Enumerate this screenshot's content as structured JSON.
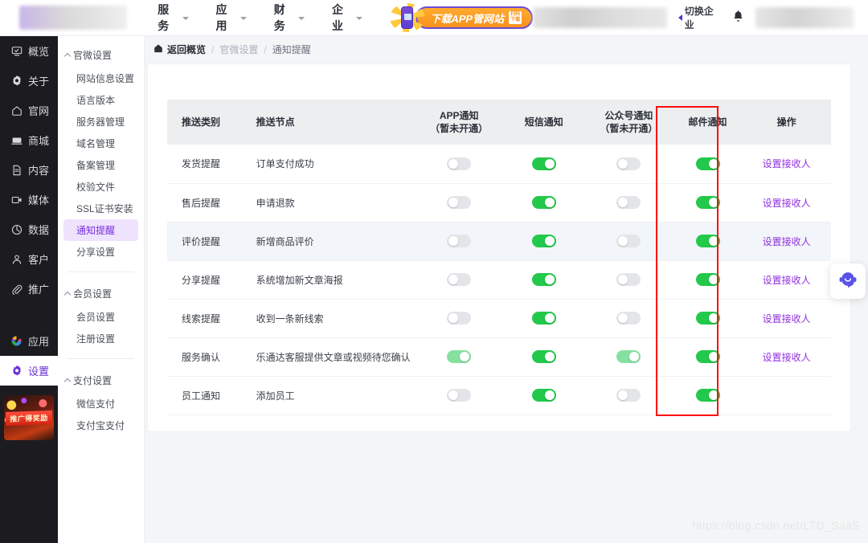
{
  "topbar": {
    "nav": [
      {
        "label": "服务",
        "icon": "chevron-down-icon"
      },
      {
        "label": "应用",
        "icon": "chevron-down-icon"
      },
      {
        "label": "财务",
        "icon": "chevron-down-icon"
      },
      {
        "label": "企业",
        "icon": "chevron-down-icon"
      }
    ],
    "promo_button": "下载APP管网站",
    "promo_badge_line1": "扫码",
    "promo_badge_line2": "下载",
    "switch_org": "切换企业",
    "bell_icon": "bell-icon"
  },
  "rail": {
    "items": [
      {
        "label": "概览",
        "icon": "overview-icon"
      },
      {
        "label": "关于",
        "icon": "gear-icon"
      },
      {
        "label": "官网",
        "icon": "home-icon"
      },
      {
        "label": "商城",
        "icon": "shop-icon"
      },
      {
        "label": "内容",
        "icon": "document-icon"
      },
      {
        "label": "媒体",
        "icon": "media-icon"
      },
      {
        "label": "数据",
        "icon": "chart-pie-icon"
      },
      {
        "label": "客户",
        "icon": "user-icon"
      },
      {
        "label": "推广",
        "icon": "paperclip-icon"
      }
    ],
    "bottom_items": [
      {
        "label": "应用",
        "icon": "apps-color-icon",
        "active": false
      },
      {
        "label": "设置",
        "icon": "gear-icon",
        "active": true
      }
    ],
    "banner_text": "推广得奖励"
  },
  "subnav": {
    "groups": [
      {
        "title": "官微设置",
        "items": [
          {
            "label": "网站信息设置",
            "active": false
          },
          {
            "label": "语言版本",
            "active": false
          },
          {
            "label": "服务器管理",
            "active": false
          },
          {
            "label": "域名管理",
            "active": false
          },
          {
            "label": "备案管理",
            "active": false
          },
          {
            "label": "校验文件",
            "active": false
          },
          {
            "label": "SSL证书安装",
            "active": false
          },
          {
            "label": "通知提醒",
            "active": true
          },
          {
            "label": "分享设置",
            "active": false
          }
        ]
      },
      {
        "title": "会员设置",
        "items": [
          {
            "label": "会员设置",
            "active": false
          },
          {
            "label": "注册设置",
            "active": false
          }
        ]
      },
      {
        "title": "支付设置",
        "items": [
          {
            "label": "微信支付",
            "active": false
          },
          {
            "label": "支付宝支付",
            "active": false
          }
        ]
      }
    ]
  },
  "breadcrumb": {
    "home_icon": "home-icon",
    "home": "返回概览",
    "sep": "/",
    "level1": "官微设置",
    "level2": "通知提醒"
  },
  "table": {
    "headers": {
      "category": "推送类别",
      "node": "推送节点",
      "app_l1": "APP通知",
      "app_l2": "（暂未开通）",
      "sms": "短信通知",
      "mp_l1": "公众号通知",
      "mp_l2": "（暂未开通）",
      "email": "邮件通知",
      "action": "操作"
    },
    "action_label": "设置接收人",
    "rows": [
      {
        "category": "发货提醒",
        "node": "订单支付成功",
        "app": "off",
        "sms": "on",
        "mp": "off",
        "email": "on",
        "action": "设置接收人"
      },
      {
        "category": "售后提醒",
        "node": "申请退款",
        "app": "off",
        "sms": "on",
        "mp": "off",
        "email": "on",
        "action": "设置接收人"
      },
      {
        "category": "评价提醒",
        "node": "新增商品评价",
        "app": "off",
        "sms": "on",
        "mp": "off",
        "email": "on",
        "action": "设置接收人"
      },
      {
        "category": "分享提醒",
        "node": "系统增加新文章海报",
        "app": "off",
        "sms": "on",
        "mp": "off",
        "email": "on",
        "action": "设置接收人"
      },
      {
        "category": "线索提醒",
        "node": "收到一条新线索",
        "app": "off",
        "sms": "on",
        "mp": "off",
        "email": "on",
        "action": "设置接收人"
      },
      {
        "category": "服务确认",
        "node": "乐通达客服提供文章或视频待您确认",
        "app": "on-light",
        "sms": "on",
        "mp": "on-light",
        "email": "on",
        "action": "设置接收人"
      },
      {
        "category": "员工通知",
        "node": "添加员工",
        "app": "off",
        "sms": "on",
        "mp": "off",
        "email": "on",
        "action": ""
      }
    ]
  },
  "highlight": {
    "name": "email-column-highlight",
    "color": "#ff0d0d"
  },
  "service_widget": {
    "icon": "headset-support-icon"
  },
  "watermark": "https://blog.csdn.net/LTD_SaaS",
  "colors": {
    "toggle_on": "#23c94a",
    "toggle_on_light": "#86e0a0",
    "toggle_off": "#e3e5e9",
    "link_purple": "#9130e0",
    "active_purple": "#7a2ee0",
    "highlight_red": "#ff0d0d"
  }
}
